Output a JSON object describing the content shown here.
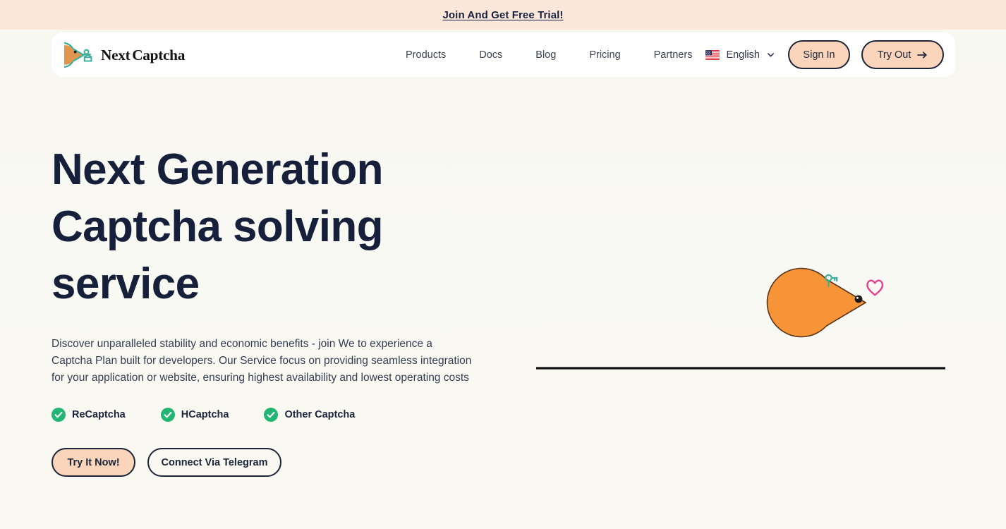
{
  "announcement": {
    "text": "Join And Get Free Trial!"
  },
  "header": {
    "brand": {
      "name": "NextCaptcha",
      "logo_icon": "pacman-key-logo-icon"
    },
    "nav": [
      {
        "label": "Products"
      },
      {
        "label": "Docs"
      },
      {
        "label": "Blog"
      },
      {
        "label": "Pricing"
      },
      {
        "label": "Partners"
      }
    ],
    "language": {
      "label": "English",
      "flag_icon": "us-flag-icon",
      "chevron_icon": "chevron-down-icon"
    },
    "sign_in_label": "Sign In",
    "try_out_label": "Try Out",
    "try_out_icon": "arrow-right-icon"
  },
  "hero": {
    "title": "Next Generation Captcha solving service",
    "description": "Discover unparalleled stability and economic benefits - join We to experience a Captcha Plan built for developers. Our Service focus on providing seamless integration for your application or website, ensuring highest availability and lowest operating costs",
    "features": [
      {
        "label": "ReCaptcha",
        "icon": "check-circle-icon"
      },
      {
        "label": "HCaptcha",
        "icon": "check-circle-icon"
      },
      {
        "label": "Other Captcha",
        "icon": "check-circle-icon"
      }
    ],
    "primary_cta": "Try It Now!",
    "secondary_cta": "Connect Via Telegram",
    "illustration": {
      "character_icon": "pacman-character-icon",
      "heart_icon": "heart-outline-icon",
      "key_icon": "key-antenna-icon",
      "ground_line_icon": "ground-line-icon"
    }
  },
  "colors": {
    "banner_bg": "#FCE7DB",
    "page_bg": "#F8F8F1",
    "header_bg": "#FFFFFF",
    "peach_accent": "#FBD5BB",
    "ink": "#17203B",
    "check_green": "#22B573",
    "pacman_orange": "#F79437",
    "heart_pink": "#E0468E",
    "key_teal": "#3BAE9B"
  }
}
